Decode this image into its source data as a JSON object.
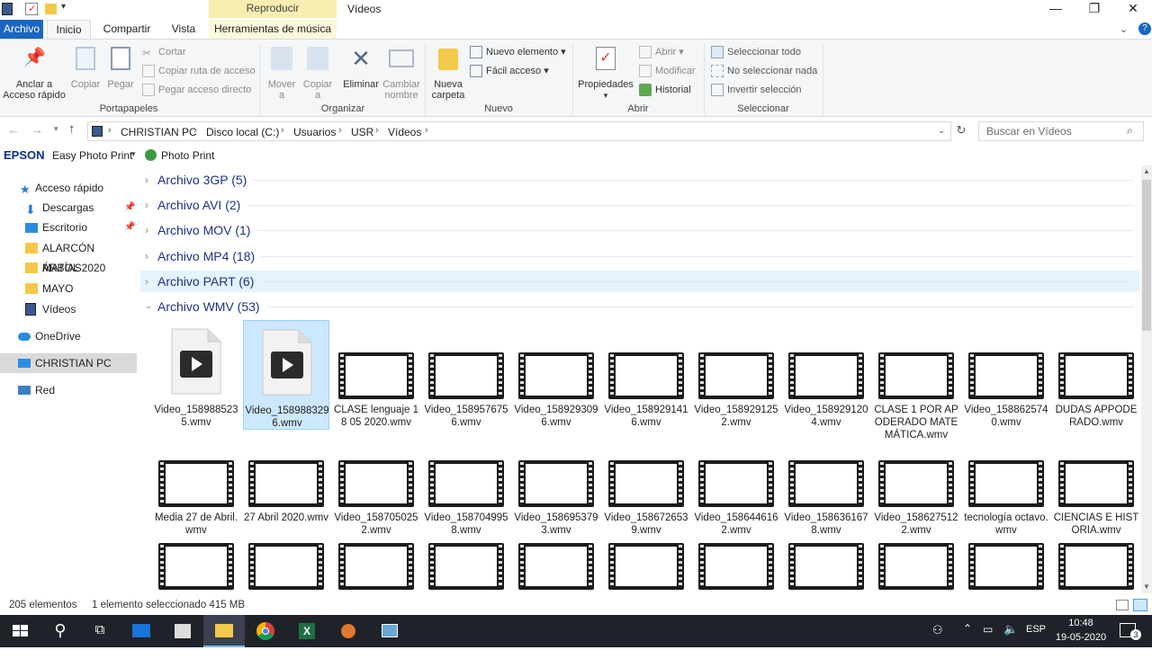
{
  "title_bar": {
    "context_tab_header": "Reproducir",
    "window_title": "Vídeos"
  },
  "tabs": {
    "archivo": "Archivo",
    "inicio": "Inicio",
    "compartir": "Compartir",
    "vista": "Vista",
    "herramientas": "Herramientas de música"
  },
  "ribbon": {
    "portapapeles": {
      "anclar": "Anclar a",
      "anclar2": "Acceso rápido",
      "copiar": "Copiar",
      "pegar": "Pegar",
      "cortar": "Cortar",
      "copiar_ruta": "Copiar ruta de acceso",
      "pegar_acceso": "Pegar acceso directo",
      "label": "Portapapeles"
    },
    "organizar": {
      "mover": "Mover",
      "mover2": "a",
      "copiar": "Copiar",
      "copiar2": "a",
      "eliminar": "Eliminar",
      "cambiar": "Cambiar",
      "cambiar2": "nombre",
      "label": "Organizar"
    },
    "nuevo": {
      "nueva": "Nueva",
      "carpeta": "carpeta",
      "nuevo_elemento": "Nuevo elemento",
      "facil_acceso": "Fácil acceso",
      "label": "Nuevo"
    },
    "abrir": {
      "propiedades": "Propiedades",
      "abrir": "Abrir",
      "modificar": "Modificar",
      "historial": "Historial",
      "label": "Abrir"
    },
    "seleccionar": {
      "todo": "Seleccionar todo",
      "nada": "No seleccionar nada",
      "invertir": "Invertir selección",
      "label": "Seleccionar"
    }
  },
  "address": {
    "crumbs": [
      "CHRISTIAN PC",
      "Disco local (C:)",
      "Usuarios",
      "USR",
      "Vídeos"
    ],
    "search_placeholder": "Buscar en Vídeos"
  },
  "epson": {
    "brand": "EPSON",
    "easy_photo": "Easy Photo Print",
    "photo_print": "Photo Print"
  },
  "nav": {
    "items": [
      "Acceso rápido",
      "Descargas",
      "Escritorio",
      "ALARCÓN MATÍAS",
      "ÁRBOL 2020",
      "MAYO",
      "Vídeos",
      "OneDrive",
      "CHRISTIAN PC",
      "Red"
    ]
  },
  "groups": [
    "Archivo 3GP (5)",
    "Archivo AVI (2)",
    "Archivo MOV (1)",
    "Archivo MP4 (18)",
    "Archivo PART (6)",
    "Archivo WMV (53)"
  ],
  "files_row1": [
    "Video_1589885235.wmv",
    "Video_1589883296.wmv",
    "CLASE lenguaje 18 05 2020.wmv",
    "Video_1589576756.wmv",
    "Video_1589293096.wmv",
    "Video_1589291416.wmv",
    "Video_1589291252.wmv",
    "Video_1589291204.wmv",
    "CLASE 1 POR APODERADO MATEMÁTICA.wmv",
    "Video_1588625740.wmv",
    "DUDAS APPODERADO.wmv"
  ],
  "files_row2": [
    "Media 27 de Abril.wmv",
    "27 Abril 2020.wmv",
    "Video_1587050252.wmv",
    "Video_1587049958.wmv",
    "Video_1586953793.wmv",
    "Video_1586726539.wmv",
    "Video_1586446162.wmv",
    "Video_1586361678.wmv",
    "Video_1586275122.wmv",
    "tecnología octavo.wmv",
    "CIENCIAS E HISTORIA.wmv"
  ],
  "status": {
    "count": "205 elementos",
    "selected": "1 elemento seleccionado  415 MB"
  },
  "taskbar": {
    "lang": "ESP",
    "time": "10:48",
    "date": "19-05-2020",
    "notif": "3"
  },
  "colors": {
    "accent": "#1a66c0",
    "group_text": "#1e3287",
    "selection": "#cce8ff",
    "taskbar": "#1f2229"
  }
}
